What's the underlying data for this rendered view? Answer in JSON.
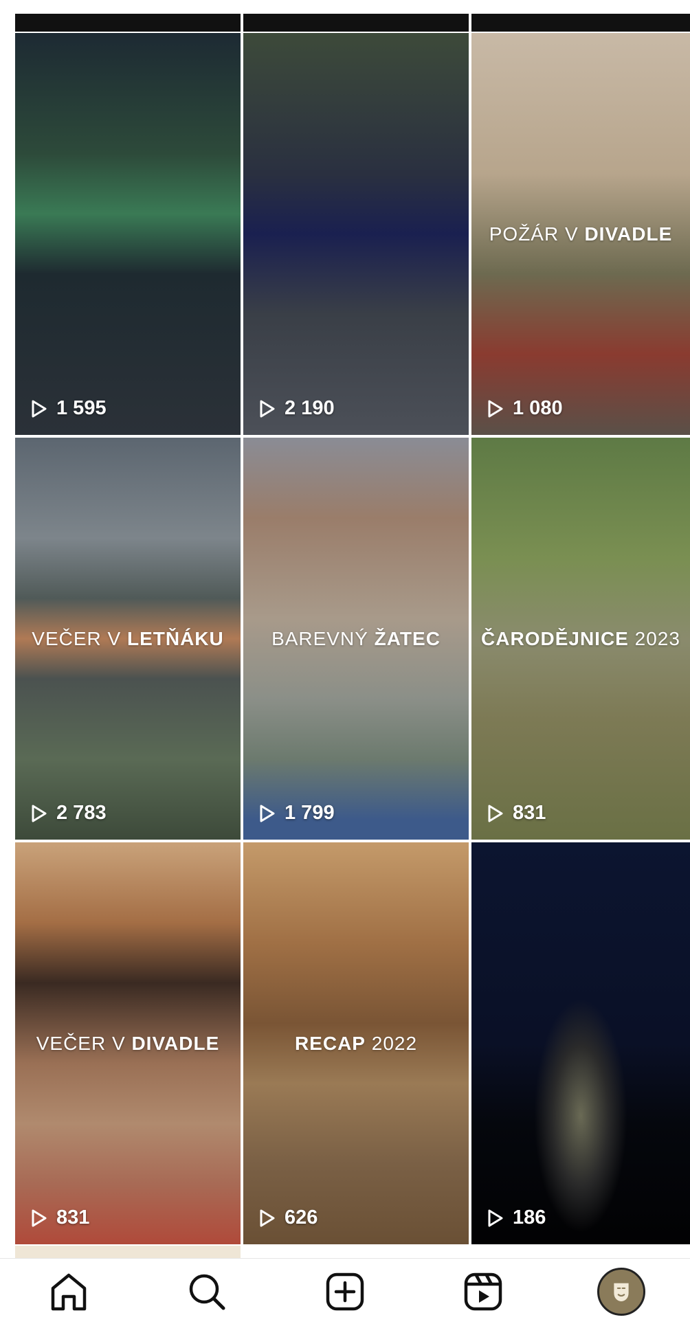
{
  "tiles": [
    {
      "title_light": "",
      "title_bold": "",
      "title_suffix": "",
      "views": "1 595",
      "scene": "concert-stage-green"
    },
    {
      "title_light": "",
      "title_bold": "",
      "title_suffix": "",
      "views": "2 190",
      "scene": "concert-stage-blue"
    },
    {
      "title_light": "POŽÁR V ",
      "title_bold": "DIVADLE",
      "title_suffix": "",
      "views": "1 080",
      "scene": "fire-drill"
    },
    {
      "title_light": "VEČER V ",
      "title_bold": "LETŇÁKU",
      "title_suffix": "",
      "views": "2 783",
      "scene": "open-air-cinema"
    },
    {
      "title_light": "BAREVNÝ ",
      "title_bold": "ŽATEC",
      "title_suffix": "",
      "views": "1 799",
      "scene": "town-square"
    },
    {
      "title_light": "",
      "title_bold": "ČARODĚJNICE",
      "title_suffix": " 2023",
      "views": "831",
      "scene": "witch-bonfire"
    },
    {
      "title_light": "VEČER V ",
      "title_bold": "DIVADLE",
      "title_suffix": "",
      "views": "831",
      "scene": "theatre-hall"
    },
    {
      "title_light": "",
      "title_bold": "RECAP",
      "title_suffix": " 2022",
      "views": "626",
      "scene": "crowd-recap"
    },
    {
      "title_light": "",
      "title_bold": "",
      "title_suffix": "",
      "views": "186",
      "scene": "night-lights"
    }
  ],
  "nav": {
    "items": [
      {
        "icon": "home-icon"
      },
      {
        "icon": "search-icon"
      },
      {
        "icon": "create-post-icon"
      },
      {
        "icon": "reels-icon"
      },
      {
        "icon": "profile-avatar"
      }
    ]
  },
  "colors": {
    "background": "#ffffff",
    "icon": "#111111",
    "text_overlay": "#ffffff"
  }
}
